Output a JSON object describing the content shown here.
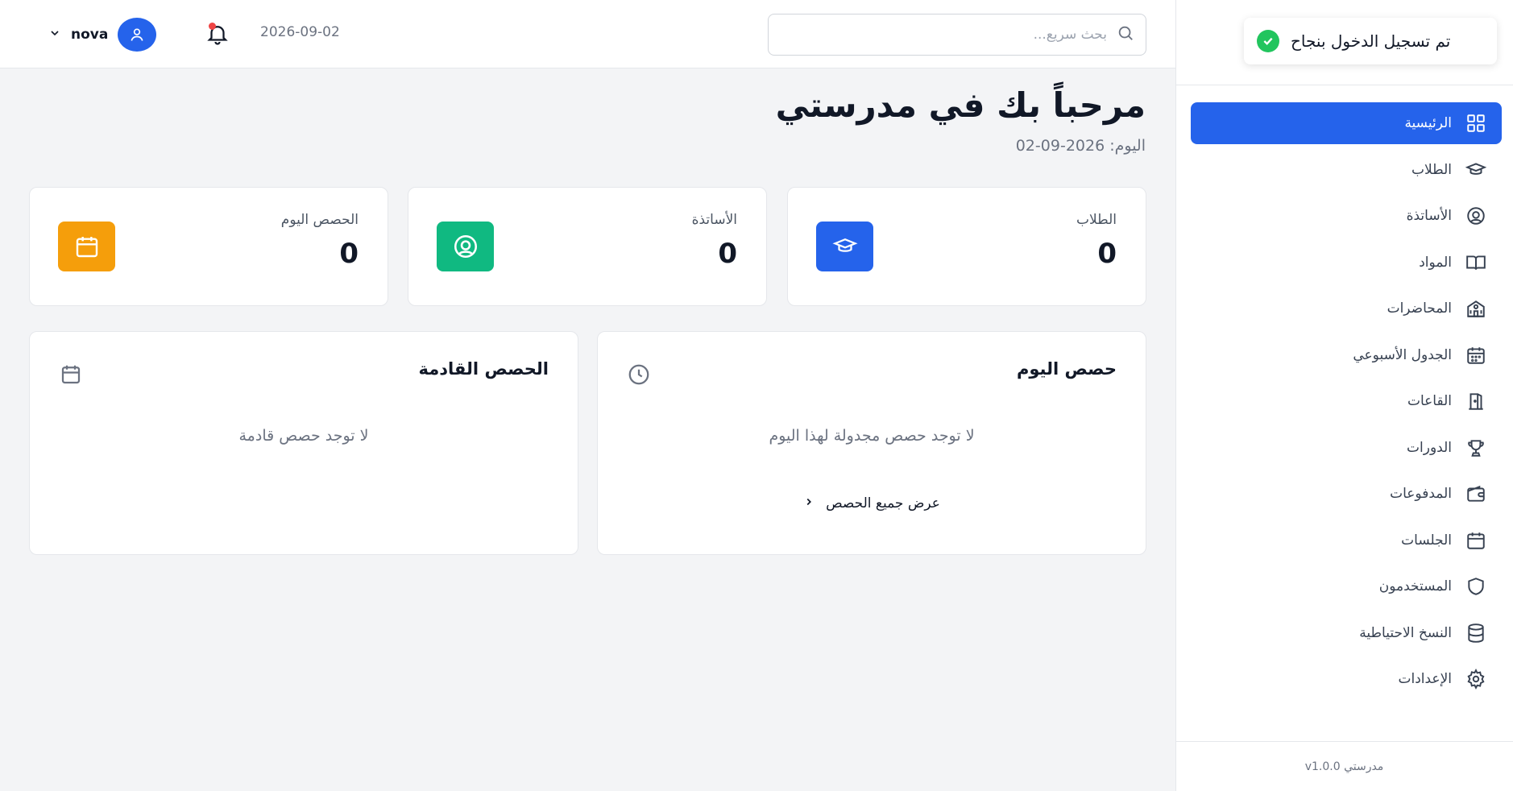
{
  "colors": {
    "primary": "#2563eb",
    "success": "#22c55e",
    "teachers": "#10b981",
    "lessons": "#f59e0b",
    "notification": "#ef4444"
  },
  "toast": {
    "text": "تم تسجيل الدخول بنجاح",
    "icon": "check-circle-icon"
  },
  "sidebar": {
    "items": [
      {
        "label": "الرئيسية",
        "icon": "dashboard-grid-icon",
        "active": true
      },
      {
        "label": "الطلاب",
        "icon": "graduation-cap-icon"
      },
      {
        "label": "الأساتذة",
        "icon": "user-circle-icon"
      },
      {
        "label": "المواد",
        "icon": "book-icon"
      },
      {
        "label": "المحاضرات",
        "icon": "school-building-icon"
      },
      {
        "label": "الجدول الأسبوعي",
        "icon": "calendar-grid-icon"
      },
      {
        "label": "القاعات",
        "icon": "door-icon"
      },
      {
        "label": "الدورات",
        "icon": "trophy-icon"
      },
      {
        "label": "المدفوعات",
        "icon": "wallet-icon"
      },
      {
        "label": "الجلسات",
        "icon": "calendar-icon"
      },
      {
        "label": "المستخدمون",
        "icon": "shield-icon"
      },
      {
        "label": "النسخ الاحتياطية",
        "icon": "database-icon"
      },
      {
        "label": "الإعدادات",
        "icon": "gear-icon"
      }
    ],
    "footer": "مدرستي v1.0.0"
  },
  "header": {
    "search_placeholder": "بحث سريع...",
    "date": "2026-09-02",
    "username": "nova"
  },
  "main": {
    "title": "مرحباً بك في مدرستي",
    "subtitle": "اليوم: 2026-09-02",
    "stats": [
      {
        "label": "الطلاب",
        "value": "0",
        "icon": "graduation-cap-icon"
      },
      {
        "label": "الأساتذة",
        "value": "0",
        "icon": "user-circle-icon"
      },
      {
        "label": "الحصص اليوم",
        "value": "0",
        "icon": "calendar-icon"
      }
    ],
    "today_panel": {
      "title": "حصص اليوم",
      "empty": "لا توجد حصص مجدولة لهذا اليوم",
      "link": "عرض جميع الحصص",
      "icon": "clock-icon"
    },
    "upcoming_panel": {
      "title": "الحصص القادمة",
      "empty": "لا توجد حصص قادمة",
      "icon": "calendar-icon"
    }
  }
}
